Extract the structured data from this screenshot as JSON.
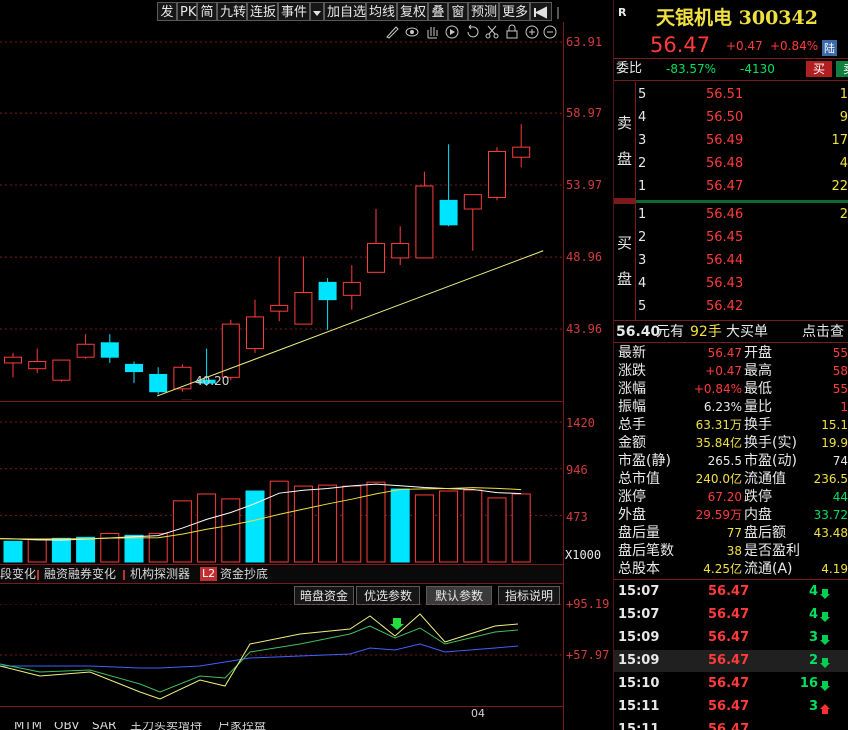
{
  "toolbar": {
    "buttons": [
      "发",
      "PK",
      "简",
      "九转",
      "连扳",
      "事件",
      "加自选",
      "均线",
      "复权",
      "叠",
      "窗",
      "预测",
      "更多"
    ],
    "dropdown_icon": "caret-down-icon",
    "pin_icon": "pin-icon"
  },
  "price_axis": [
    "63.91",
    "58.97",
    "53.97",
    "48.96",
    "43.96"
  ],
  "low_annotation": "40.20",
  "volume_axis": [
    "1420",
    "946",
    "473",
    "X1000"
  ],
  "indicator_tabs": [
    "段变化",
    "融资融券变化",
    "机构探测器",
    "L2",
    "资金抄底"
  ],
  "indicator_buttons": [
    "暗盘资金",
    "优选参数",
    "默认参数",
    "指标说明"
  ],
  "indicator_axis": [
    "+95.19",
    "+57.97"
  ],
  "date_label": "04",
  "bottom_tabs": [
    "MTM",
    "OBV",
    "SAR",
    "主力买卖增持",
    "户家控盘"
  ],
  "stock": {
    "badge": "R",
    "name": "天银机电",
    "code": "300342",
    "price": "56.47",
    "change": "+0.47",
    "change_pct": "+0.84%",
    "market_badge": "陆"
  },
  "commission": {
    "label": "委比",
    "ratio": "-83.57%",
    "diff": "-4130",
    "buy_label": "买",
    "sell_label": "卖"
  },
  "sell_side_label": [
    "卖",
    "盘"
  ],
  "buy_side_label": [
    "买",
    "盘"
  ],
  "asks": [
    {
      "level": "5",
      "price": "56.51",
      "vol": "1"
    },
    {
      "level": "4",
      "price": "56.50",
      "vol": "9"
    },
    {
      "level": "3",
      "price": "56.49",
      "vol": "17"
    },
    {
      "level": "2",
      "price": "56.48",
      "vol": "4"
    },
    {
      "level": "1",
      "price": "56.47",
      "vol": "22"
    }
  ],
  "bids": [
    {
      "level": "1",
      "price": "56.46",
      "vol": "2"
    },
    {
      "level": "2",
      "price": "56.45",
      "vol": ""
    },
    {
      "level": "3",
      "price": "56.44",
      "vol": ""
    },
    {
      "level": "4",
      "price": "56.43",
      "vol": ""
    },
    {
      "level": "5",
      "price": "56.42",
      "vol": ""
    }
  ],
  "big_order": {
    "price": "56.40",
    "unit": "元有",
    "qty": "92手",
    "label": "大买单",
    "action": "点击查"
  },
  "stats": [
    {
      "l1": "最新",
      "v1": "56.47",
      "c1": "red",
      "l2": "开盘",
      "v2": "55",
      "c2": "red"
    },
    {
      "l1": "涨跌",
      "v1": "+0.47",
      "c1": "red",
      "l2": "最高",
      "v2": "58",
      "c2": "red"
    },
    {
      "l1": "涨幅",
      "v1": "+0.84%",
      "c1": "red",
      "l2": "最低",
      "v2": "55",
      "c2": "red"
    },
    {
      "l1": "振幅",
      "v1": "6.23%",
      "c1": "white",
      "l2": "量比",
      "v2": "1",
      "c2": "red"
    },
    {
      "l1": "总手",
      "v1": "63.31万",
      "c1": "yellow",
      "l2": "换手",
      "v2": "15.1",
      "c2": "yellow"
    },
    {
      "l1": "金额",
      "v1": "35.84亿",
      "c1": "yellow",
      "l2": "换手(实)",
      "v2": "19.9",
      "c2": "yellow"
    },
    {
      "l1": "市盈(静)",
      "v1": "265.5",
      "c1": "white",
      "l2": "市盈(动)",
      "v2": "74",
      "c2": "white"
    },
    {
      "l1": "总市值",
      "v1": "240.0亿",
      "c1": "yellow",
      "l2": "流通值",
      "v2": "236.5",
      "c2": "yellow"
    },
    {
      "l1": "涨停",
      "v1": "67.20",
      "c1": "red",
      "l2": "跌停",
      "v2": "44",
      "c2": "green"
    },
    {
      "l1": "外盘",
      "v1": "29.59万",
      "c1": "red",
      "l2": "内盘",
      "v2": "33.72",
      "c2": "green"
    },
    {
      "l1": "盘后量",
      "v1": "77",
      "c1": "yellow",
      "l2": "盘后额",
      "v2": "43.48",
      "c2": "yellow"
    },
    {
      "l1": "盘后笔数",
      "v1": "38",
      "c1": "yellow",
      "l2": "是否盈利",
      "v2": "",
      "c2": "white"
    },
    {
      "l1": "总股本",
      "v1": "4.25亿",
      "c1": "yellow",
      "l2": "流通(A)",
      "v2": "4.19",
      "c2": "yellow"
    }
  ],
  "ticks": [
    {
      "time": "15:07",
      "price": "56.47",
      "vol": "4",
      "dir": "down"
    },
    {
      "time": "15:07",
      "price": "56.47",
      "vol": "4",
      "dir": "down"
    },
    {
      "time": "15:09",
      "price": "56.47",
      "vol": "3",
      "dir": "down"
    },
    {
      "time": "15:09",
      "price": "56.47",
      "vol": "2",
      "dir": "down"
    },
    {
      "time": "15:10",
      "price": "56.47",
      "vol": "16",
      "dir": "down"
    },
    {
      "time": "15:11",
      "price": "56.47",
      "vol": "3",
      "dir": "up"
    },
    {
      "time": "15:11",
      "price": "56.47",
      "vol": "",
      "dir": ""
    }
  ],
  "colors": {
    "up": "#ff3b3b",
    "down": "#00e5ff",
    "grid": "#7a1a1a",
    "ma5": "#ffffff",
    "ma10": "#f0e040",
    "trendline": "#f0f080"
  },
  "chart_data": {
    "type": "candlestick",
    "price_ticks": [
      63.91,
      58.97,
      53.97,
      48.96,
      43.96
    ],
    "ylim": [
      39.0,
      65.0
    ],
    "low_annotation": 40.2,
    "candles": [
      {
        "o": 41.6,
        "c": 42.0,
        "h": 42.3,
        "l": 40.6
      },
      {
        "o": 41.2,
        "c": 41.7,
        "h": 42.6,
        "l": 40.9
      },
      {
        "o": 40.4,
        "c": 41.8,
        "h": 41.8,
        "l": 40.3
      },
      {
        "o": 42.0,
        "c": 42.9,
        "h": 43.6,
        "l": 41.9
      },
      {
        "o": 43.0,
        "c": 42.0,
        "h": 43.6,
        "l": 41.6
      },
      {
        "o": 41.5,
        "c": 41.0,
        "h": 41.7,
        "l": 40.2
      },
      {
        "o": 40.8,
        "c": 39.6,
        "h": 41.3,
        "l": 39.4
      },
      {
        "o": 39.8,
        "c": 41.3,
        "h": 41.5,
        "l": 39.6
      },
      {
        "o": 40.4,
        "c": 40.2,
        "h": 42.6,
        "l": 40.0
      },
      {
        "o": 40.6,
        "c": 44.3,
        "h": 44.6,
        "l": 40.4
      },
      {
        "o": 42.6,
        "c": 44.8,
        "h": 46.0,
        "l": 42.3
      },
      {
        "o": 45.2,
        "c": 45.6,
        "h": 49.0,
        "l": 44.5
      },
      {
        "o": 44.3,
        "c": 46.5,
        "h": 49.0,
        "l": 44.3
      },
      {
        "o": 47.2,
        "c": 46.0,
        "h": 47.5,
        "l": 43.9
      },
      {
        "o": 46.3,
        "c": 47.2,
        "h": 48.4,
        "l": 45.3
      },
      {
        "o": 47.9,
        "c": 49.9,
        "h": 52.3,
        "l": 47.9
      },
      {
        "o": 48.9,
        "c": 49.9,
        "h": 51.1,
        "l": 48.4
      },
      {
        "o": 48.9,
        "c": 53.9,
        "h": 54.9,
        "l": 48.9
      },
      {
        "o": 52.9,
        "c": 51.2,
        "h": 56.8,
        "l": 51.1
      },
      {
        "o": 52.3,
        "c": 53.3,
        "h": 53.3,
        "l": 49.4
      },
      {
        "o": 53.1,
        "c": 56.3,
        "h": 56.6,
        "l": 52.9
      },
      {
        "o": 55.9,
        "c": 56.6,
        "h": 58.2,
        "l": 55.2
      }
    ],
    "volume_ticks": [
      1420,
      946,
      473
    ],
    "volume_unit": "X1000",
    "volume_ylim": [
      0,
      1600
    ],
    "volumes": [
      280,
      250,
      200,
      230,
      210,
      230,
      240,
      250,
      290,
      270,
      290,
      620,
      690,
      640,
      720,
      820,
      770,
      780,
      770,
      810,
      740,
      680,
      720,
      730,
      650,
      690
    ],
    "volume_up": [
      true,
      true,
      true,
      true,
      false,
      true,
      false,
      false,
      true,
      false,
      true,
      true,
      true,
      true,
      false,
      true,
      true,
      true,
      true,
      true,
      false,
      true,
      true,
      true,
      true,
      true
    ]
  }
}
